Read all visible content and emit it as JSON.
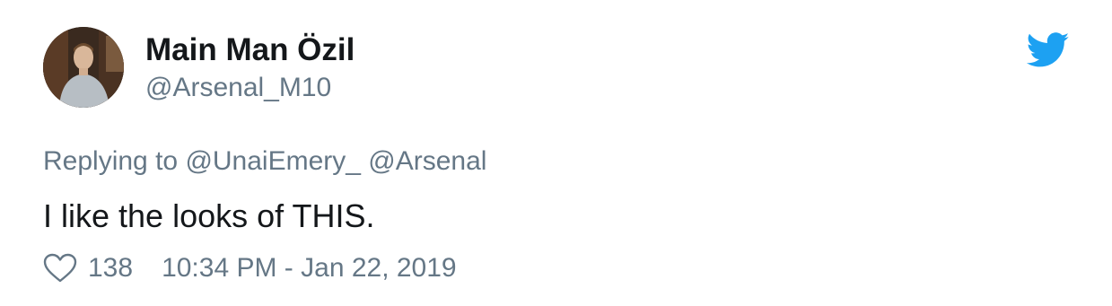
{
  "tweet": {
    "author": {
      "display_name": "Main Man Özil",
      "handle": "@Arsenal_M10",
      "avatar": "profile-photo"
    },
    "brand_icon": "twitter-bird-icon",
    "brand_color": "#1da1f2",
    "replying_prefix": "Replying to",
    "replying_to": [
      "@UnaiEmery_",
      "@Arsenal"
    ],
    "text": "I like the looks of THIS.",
    "like_icon": "heart-icon",
    "likes": "138",
    "timestamp": "10:34 PM - Jan 22, 2019"
  },
  "colors": {
    "primary_text": "#14171a",
    "secondary_text": "#657786"
  }
}
